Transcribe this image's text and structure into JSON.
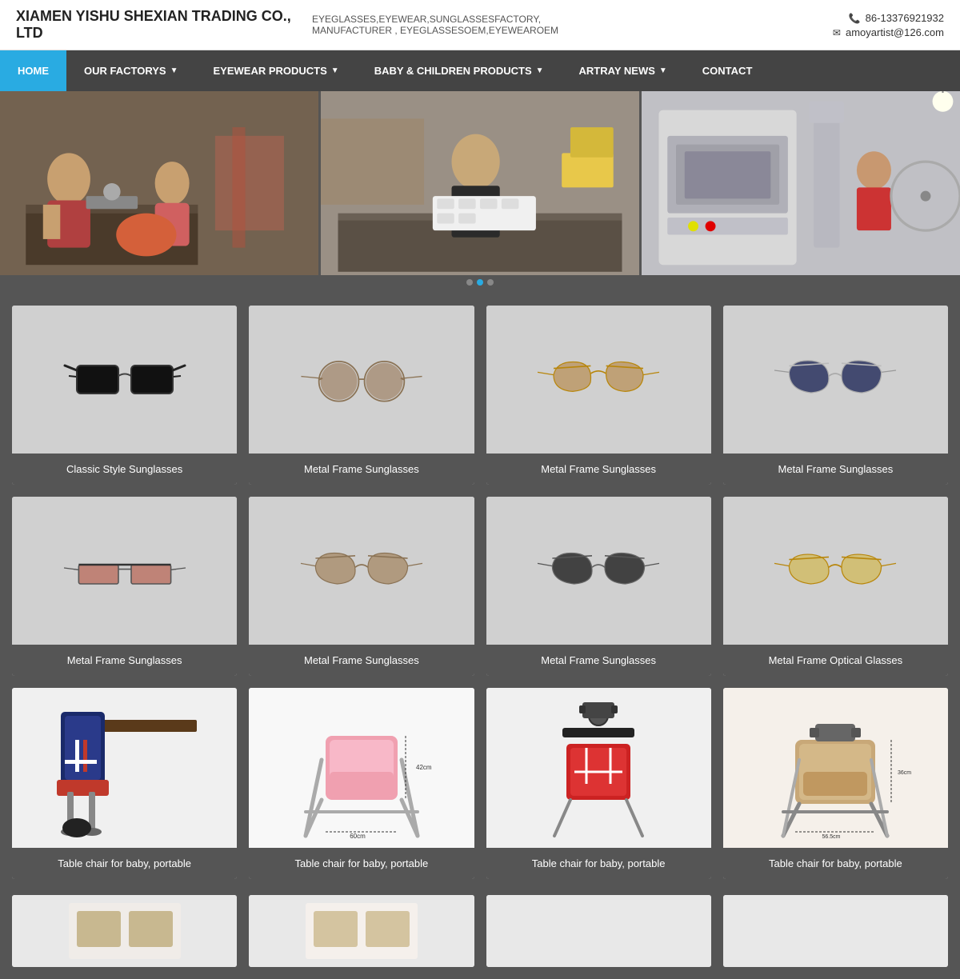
{
  "company": {
    "name": "XIAMEN YISHU SHEXIAN TRADING CO., LTD",
    "tagline_line1": "EYEGLASSES,EYEWEAR,SUNGLASSESFACTORY,",
    "tagline_line2": "MANUFACTURER , EYEGLASSESOEM,EYEWEAROEM",
    "phone": "86-13376921932",
    "email": "amoyartist@126.com"
  },
  "nav": {
    "items": [
      {
        "label": "HOME",
        "active": true,
        "has_arrow": false
      },
      {
        "label": "OUR FACTORYS",
        "active": false,
        "has_arrow": true
      },
      {
        "label": "EYEWEAR PRODUCTS",
        "active": false,
        "has_arrow": true
      },
      {
        "label": "BABY & CHILDREN PRODUCTS",
        "active": false,
        "has_arrow": true
      },
      {
        "label": "ARTRAY NEWS",
        "active": false,
        "has_arrow": true
      },
      {
        "label": "CONTACT",
        "active": false,
        "has_arrow": false
      }
    ]
  },
  "products": [
    {
      "label": "Classic Style Sunglasses",
      "type": "sunglasses",
      "style": "classic_black"
    },
    {
      "label": "Metal Frame Sunglasses",
      "type": "sunglasses",
      "style": "metal_round_brown"
    },
    {
      "label": "Metal Frame Sunglasses",
      "type": "sunglasses",
      "style": "metal_aviator_gold"
    },
    {
      "label": "Metal Frame Sunglasses",
      "type": "sunglasses",
      "style": "metal_aviator_navy"
    },
    {
      "label": "Metal Frame Sunglasses",
      "type": "sunglasses",
      "style": "metal_bar_red"
    },
    {
      "label": "Metal Frame Sunglasses",
      "type": "sunglasses",
      "style": "metal_aviator_brown2"
    },
    {
      "label": "Metal Frame Sunglasses",
      "type": "sunglasses",
      "style": "metal_aviator_black"
    },
    {
      "label": "Metal Frame Optical Glasses",
      "type": "sunglasses",
      "style": "metal_aviator_yellow"
    },
    {
      "label": "Table chair for baby, portable",
      "type": "baby",
      "style": "baby1"
    },
    {
      "label": "Table chair for baby, portable",
      "type": "baby",
      "style": "baby2"
    },
    {
      "label": "Table chair for baby, portable",
      "type": "baby",
      "style": "baby3"
    },
    {
      "label": "Table chair for baby, portable",
      "type": "baby",
      "style": "baby4"
    }
  ],
  "carousel_dots": 3,
  "active_dot": 1
}
